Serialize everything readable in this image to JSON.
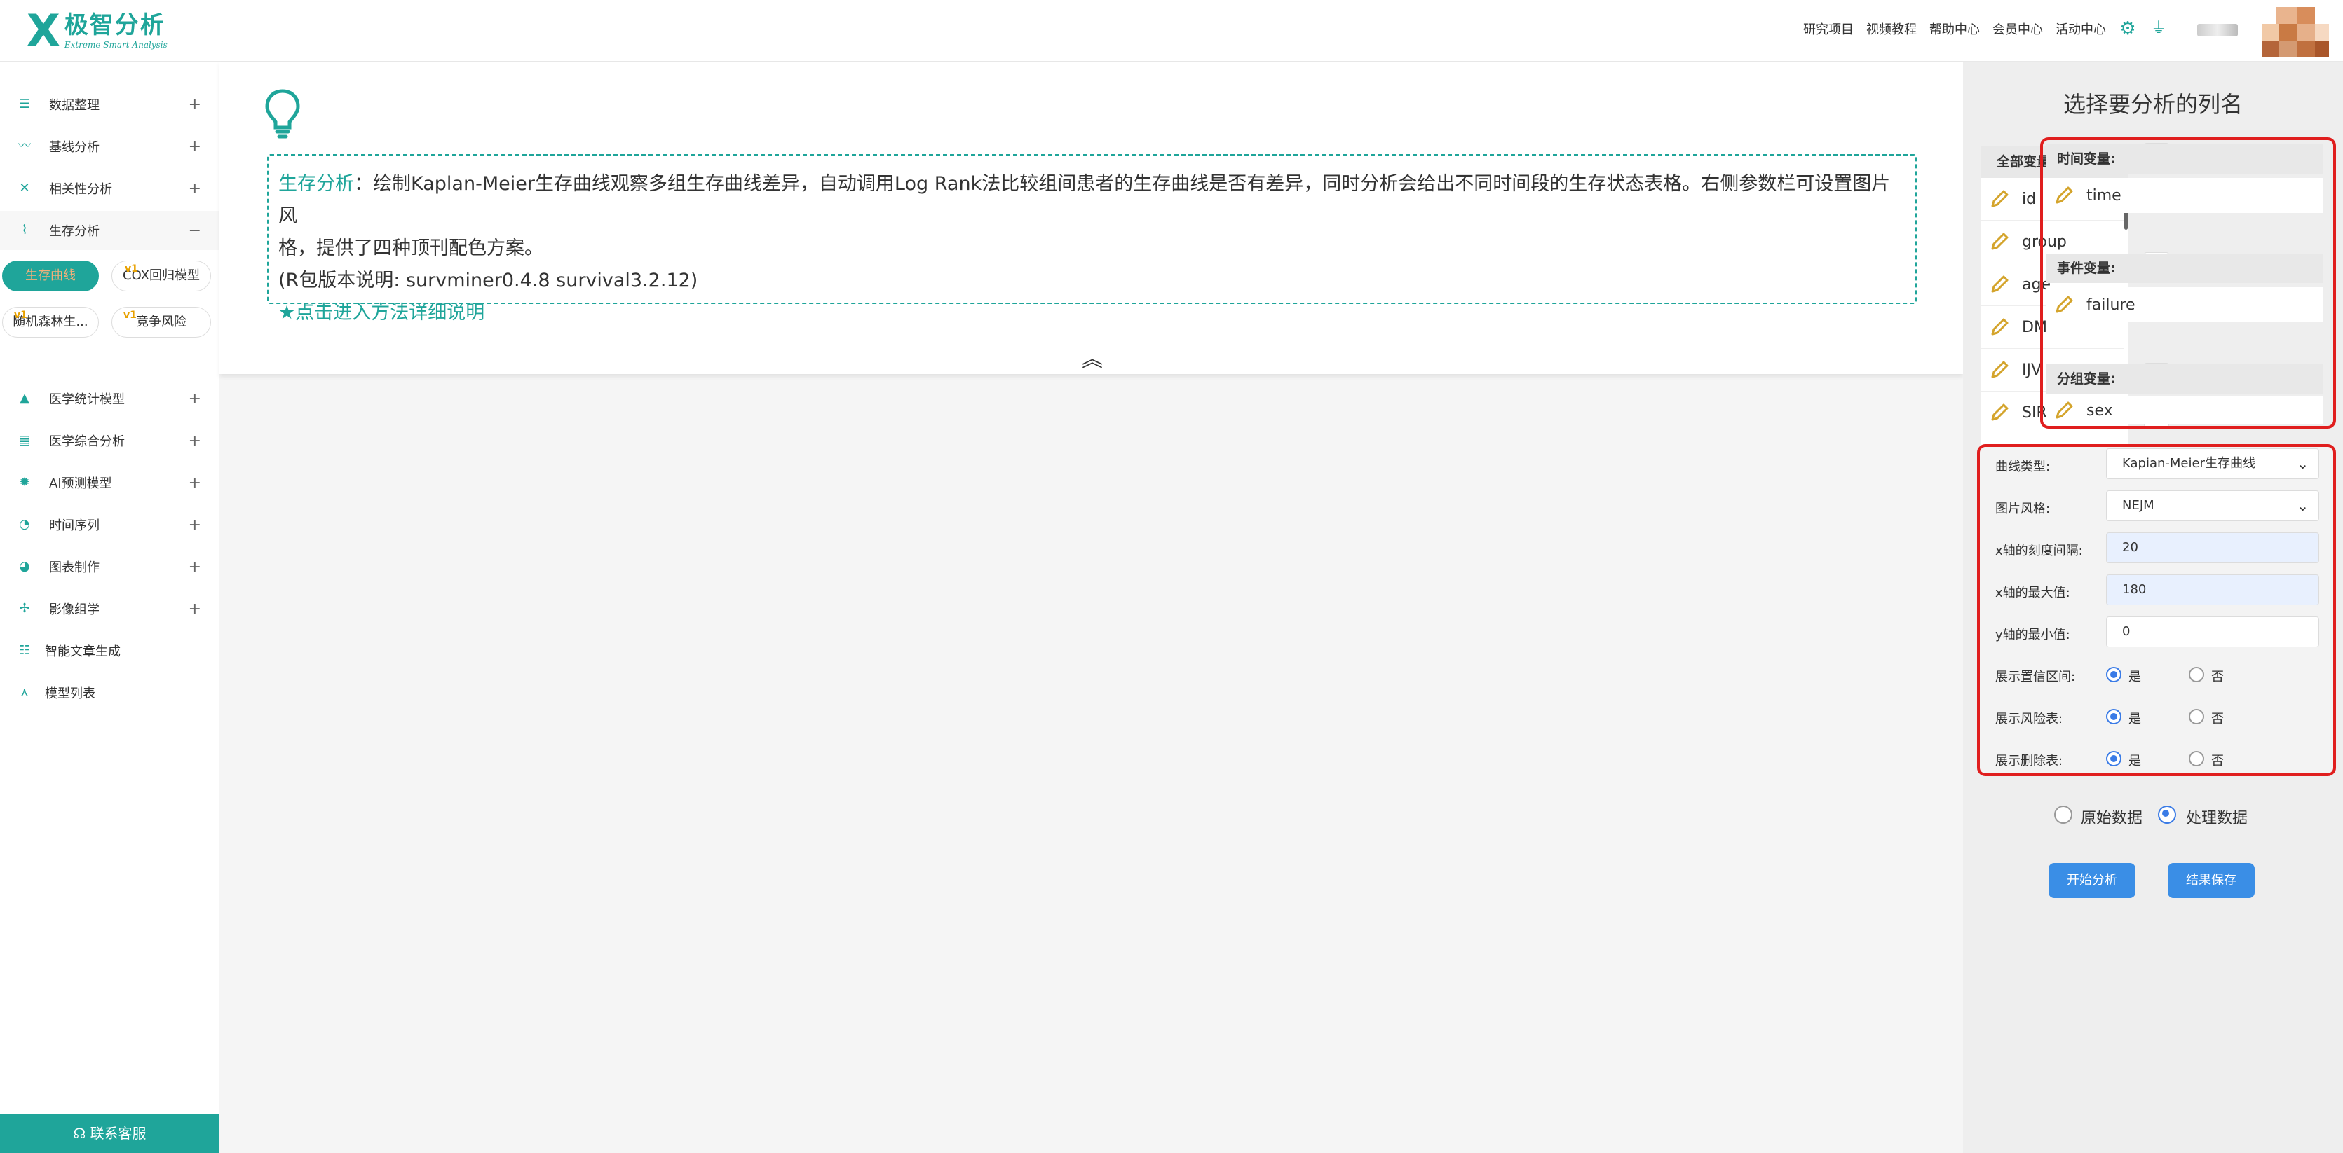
{
  "header": {
    "logo_cn": "极智分析",
    "logo_en": "Extreme Smart Analysis",
    "nav": [
      "研究项目",
      "视频教程",
      "帮助中心",
      "会员中心",
      "活动中心"
    ]
  },
  "sidebar": {
    "items": [
      {
        "label": "数据整理",
        "toggle": "+"
      },
      {
        "label": "基线分析",
        "toggle": "+"
      },
      {
        "label": "相关性分析",
        "toggle": "+"
      },
      {
        "label": "生存分析",
        "toggle": "−"
      },
      {
        "label": "医学统计模型",
        "toggle": "+"
      },
      {
        "label": "医学综合分析",
        "toggle": "+"
      },
      {
        "label": "AI预测模型",
        "toggle": "+"
      },
      {
        "label": "时间序列",
        "toggle": "+"
      },
      {
        "label": "图表制作",
        "toggle": "+"
      },
      {
        "label": "影像组学",
        "toggle": "+"
      },
      {
        "label": "智能文章生成",
        "toggle": ""
      },
      {
        "label": "模型列表",
        "toggle": ""
      }
    ],
    "sub": {
      "km": "生存曲线",
      "cox": "COX回归模型",
      "rf": "随机森林生...",
      "compete": "竞争风险",
      "badge": "v1"
    },
    "contact": "联系客服"
  },
  "intro": {
    "title_hl": "生存分析",
    "line1": "：绘制Kaplan-Meier生存曲线观察多组生存曲线差异，自动调用Log Rank法比较组间患者的生存曲线是否有差异，同时分析会给出不同时间段的生存状态表格。右侧参数栏可设置图片风",
    "line2": "格，提供了四种顶刊配色方案。",
    "line3": "(R包版本说明: survminer0.4.8 survival3.2.12)",
    "link": "★点击进入方法详细说明"
  },
  "panel": {
    "title": "选择要分析的列名",
    "all_vars": "全部变量",
    "vars": [
      "id",
      "group",
      "age",
      "DM",
      "IJV",
      "SIRI"
    ],
    "time_var": {
      "head": "时间变量:",
      "value": "time"
    },
    "event_var": {
      "head": "事件变量:",
      "value": "failure"
    },
    "group_var": {
      "head": "分组变量:",
      "value": "sex"
    }
  },
  "params": {
    "curve_type": {
      "label": "曲线类型:",
      "value": "Kapian-Meier生存曲线"
    },
    "style": {
      "label": "图片风格:",
      "value": "NEJM"
    },
    "x_tick": {
      "label": "x轴的刻度间隔:",
      "value": "20"
    },
    "x_max": {
      "label": "x轴的最大值:",
      "value": "180"
    },
    "y_min": {
      "label": "y轴的最小值:",
      "value": "0"
    },
    "show_ci": {
      "label": "展示置信区间:"
    },
    "show_risk": {
      "label": "展示风险表:"
    },
    "show_censor": {
      "label": "展示删除表:"
    },
    "yes": "是",
    "no": "否"
  },
  "data_choice": {
    "raw": "原始数据",
    "processed": "处理数据"
  },
  "buttons": {
    "start": "开始分析",
    "save": "结果保存"
  },
  "colors": {
    "accent": "#1fa59a",
    "primary": "#3a8ee6",
    "highlight": "#e01e1e"
  }
}
